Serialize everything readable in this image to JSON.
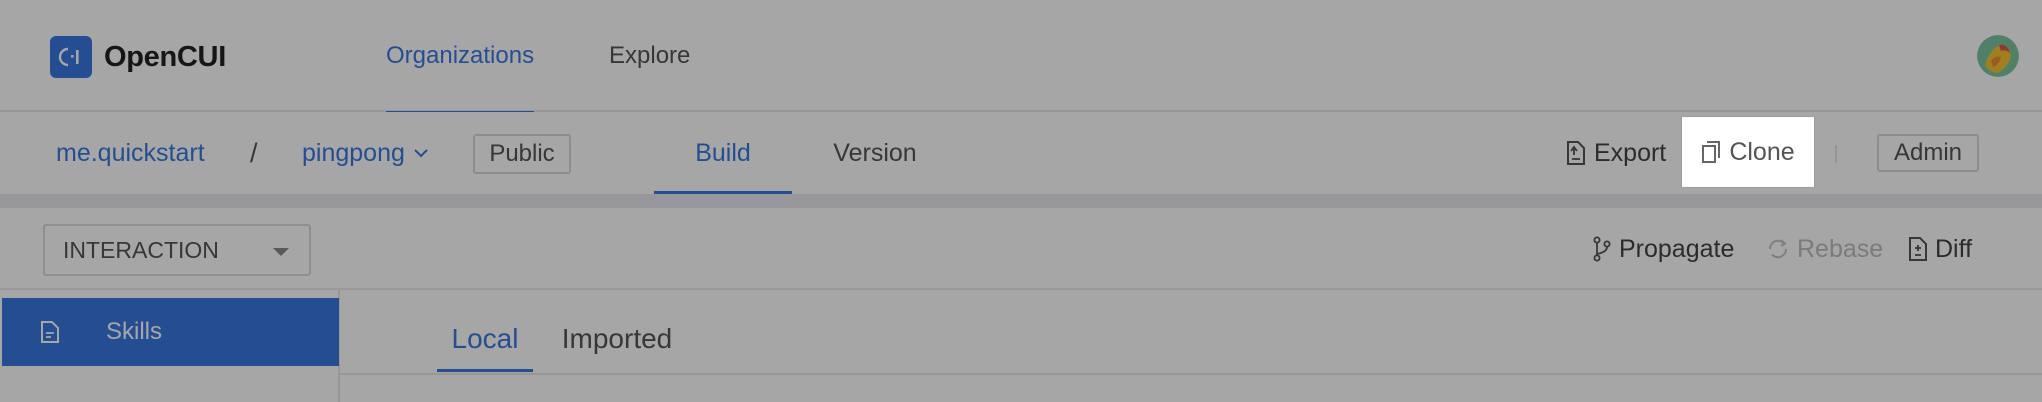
{
  "header": {
    "logo_text": "OpenCUI",
    "nav": [
      {
        "label": "Organizations",
        "active": true
      },
      {
        "label": "Explore",
        "active": false
      }
    ]
  },
  "project_bar": {
    "org": "me.quickstart",
    "separator": "/",
    "project": "pingpong",
    "visibility": "Public",
    "tabs": [
      {
        "label": "Build",
        "active": true
      },
      {
        "label": "Version",
        "active": false
      }
    ],
    "actions": {
      "export": "Export",
      "clone": "Clone",
      "admin": "Admin"
    }
  },
  "toolbar": {
    "select_value": "INTERACTION",
    "propagate": "Propagate",
    "rebase": "Rebase",
    "diff": "Diff"
  },
  "sidebar": {
    "items": [
      {
        "label": "Skills",
        "active": true
      }
    ]
  },
  "content": {
    "tabs": [
      {
        "label": "Local",
        "active": true
      },
      {
        "label": "Imported",
        "active": false
      }
    ]
  },
  "colors": {
    "accent": "#3a79e0",
    "overlay": "rgba(0,0,0,0.35)"
  }
}
